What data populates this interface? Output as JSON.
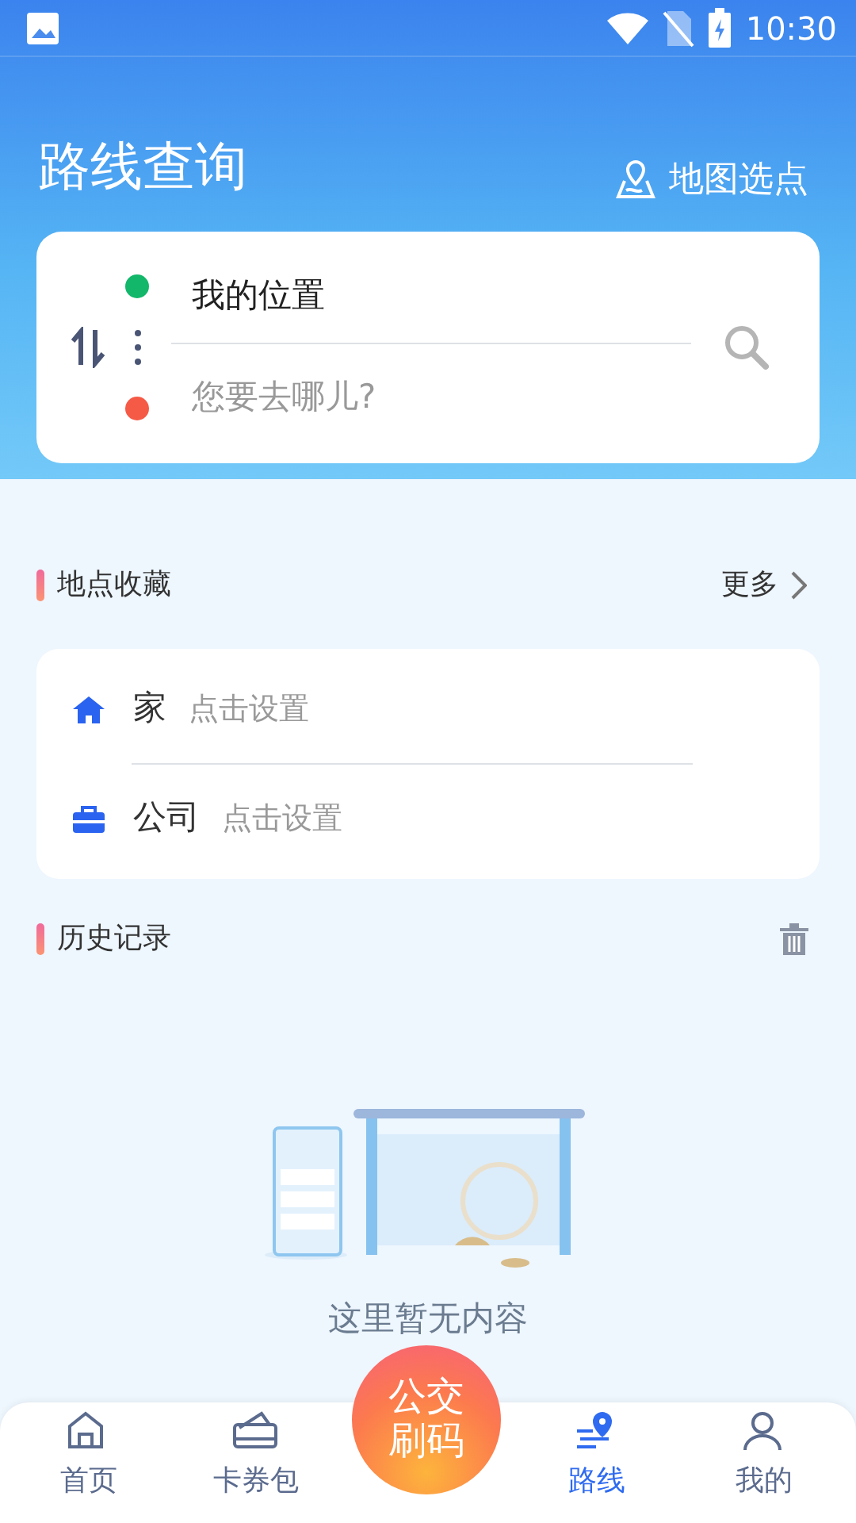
{
  "status_bar": {
    "time": "10:30"
  },
  "header": {
    "title": "路线查询",
    "map_pick": "地图选点"
  },
  "route": {
    "origin": "我的位置",
    "destination_placeholder": "您要去哪儿?"
  },
  "favorites": {
    "title": "地点收藏",
    "more": "更多",
    "items": [
      {
        "kind": "home",
        "name": "家",
        "hint": "点击设置"
      },
      {
        "kind": "work",
        "name": "公司",
        "hint": "点击设置"
      }
    ]
  },
  "history": {
    "title": "历史记录",
    "empty_text": "这里暂无内容"
  },
  "center_button": {
    "lines": [
      "公交",
      "刷码"
    ]
  },
  "tabs": [
    {
      "kind": "home",
      "label": "首页",
      "selected": false
    },
    {
      "kind": "wallet",
      "label": "卡券包",
      "selected": false
    },
    {
      "kind": "route",
      "label": "路线",
      "selected": true
    },
    {
      "kind": "me",
      "label": "我的",
      "selected": false
    }
  ]
}
